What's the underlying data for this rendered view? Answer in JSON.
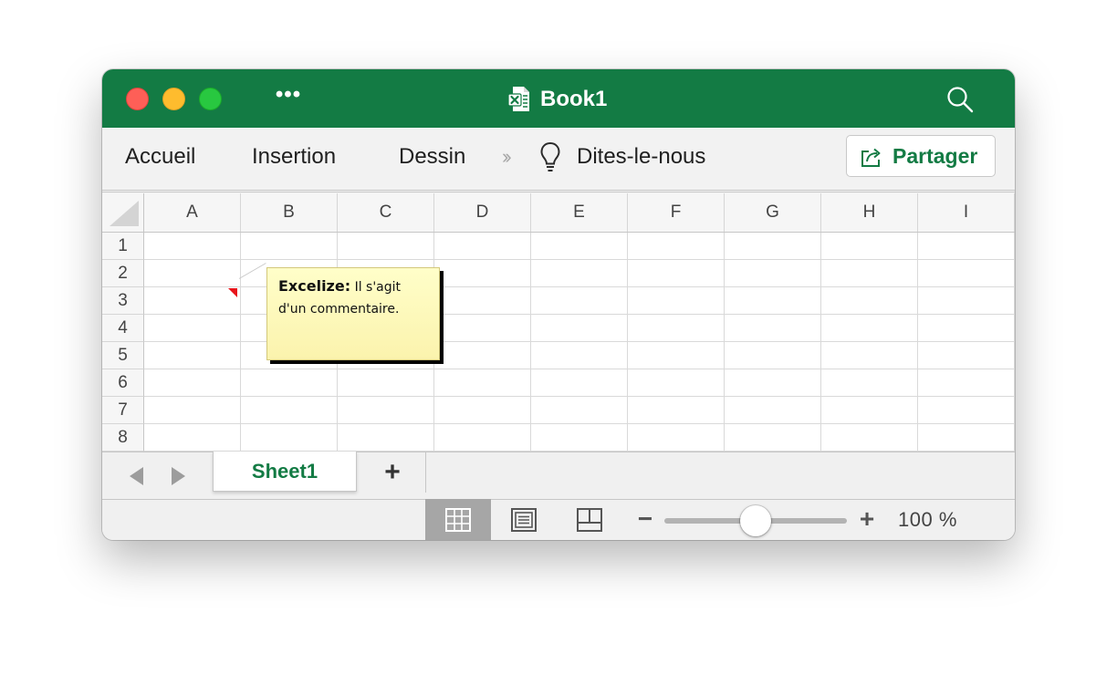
{
  "window": {
    "title": "Book1",
    "menu_more": "•••"
  },
  "ribbon": {
    "tabs": [
      "Accueil",
      "Insertion",
      "Dessin"
    ],
    "overflow": "»",
    "tell_me": "Dites-le-nous",
    "share_label": "Partager"
  },
  "grid": {
    "columns": [
      "A",
      "B",
      "C",
      "D",
      "E",
      "F",
      "G",
      "H",
      "I"
    ],
    "rows": [
      "1",
      "2",
      "3",
      "4",
      "5",
      "6",
      "7",
      "8"
    ]
  },
  "comment": {
    "author": "Excelize:",
    "text": " Il s'agit d'un commentaire."
  },
  "sheets": {
    "tabs": [
      "Sheet1"
    ],
    "add_label": "+"
  },
  "status": {
    "zoom_minus": "−",
    "zoom_plus": "+",
    "zoom_label": "100 %",
    "zoom_fraction": 0.5
  },
  "colors": {
    "brand": "#137b44",
    "comment_marker": "#e8141b",
    "comment_fill": "#fbf3ad"
  },
  "icons": [
    "close-icon",
    "minimize-icon",
    "maximize-icon",
    "more-icon",
    "excel-document-icon",
    "search-icon",
    "chevron-double-right-icon",
    "lightbulb-icon",
    "share-icon",
    "chevron-left-icon",
    "chevron-right-icon",
    "normal-view-icon",
    "page-layout-icon",
    "page-break-icon"
  ]
}
